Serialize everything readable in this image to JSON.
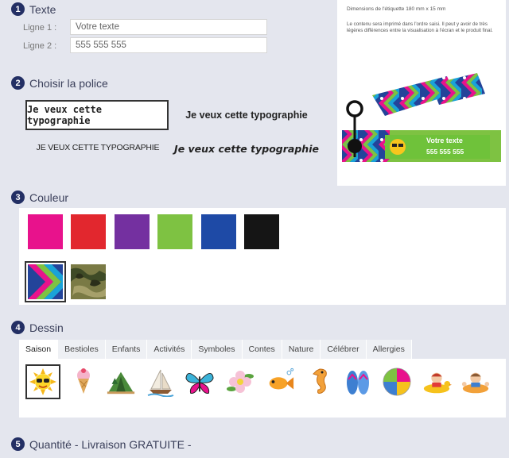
{
  "steps": {
    "texte": {
      "num": "1",
      "title": "Texte"
    },
    "police": {
      "num": "2",
      "title": "Choisir la police"
    },
    "couleur": {
      "num": "3",
      "title": "Couleur"
    },
    "dessin": {
      "num": "4",
      "title": "Dessin"
    },
    "quantite": {
      "num": "5",
      "title": "Quantité - Livraison GRATUITE -"
    }
  },
  "texte": {
    "line1_label": "Ligne 1 :",
    "line1_value": "Votre texte",
    "line2_label": "Ligne 2 :",
    "line2_value": "555 555 555"
  },
  "fonts": [
    "Je veux cette typographie",
    "Je veux cette typographie",
    "JE VEUX CETTE TYPOGRAPHIE",
    "Je veux cette typographie"
  ],
  "colors": {
    "swatches": [
      "#e8128c",
      "#e2272e",
      "#7430a0",
      "#7ec242",
      "#1e4aa6",
      "#151515"
    ],
    "patterns": [
      "chevron-rainbow",
      "camouflage"
    ]
  },
  "dessin": {
    "tabs": [
      "Saison",
      "Bestioles",
      "Enfants",
      "Activités",
      "Symboles",
      "Contes",
      "Nature",
      "Célébrer",
      "Allergies"
    ],
    "active_tab": "Saison",
    "icons": [
      "sun-with-sunglasses-icon",
      "ice-cream-icon",
      "tent-icon",
      "sailboat-icon",
      "butterfly-icon",
      "flower-icon",
      "fish-icon",
      "seahorse-icon",
      "flip-flops-icon",
      "beach-ball-icon",
      "child-swimming-duck-icon",
      "child-swimming-float-icon"
    ]
  },
  "preview": {
    "dimensions": "Dimensions de l'étiquette 180 mm x 15 mm",
    "note": "Le contenu sera imprimé dans l'ordre saisi. Il peut y avoir de très légères différences entre la visualisation à l'écran et le produit final.",
    "label_line1": "Votre texte",
    "label_line2": "555 555 555"
  }
}
